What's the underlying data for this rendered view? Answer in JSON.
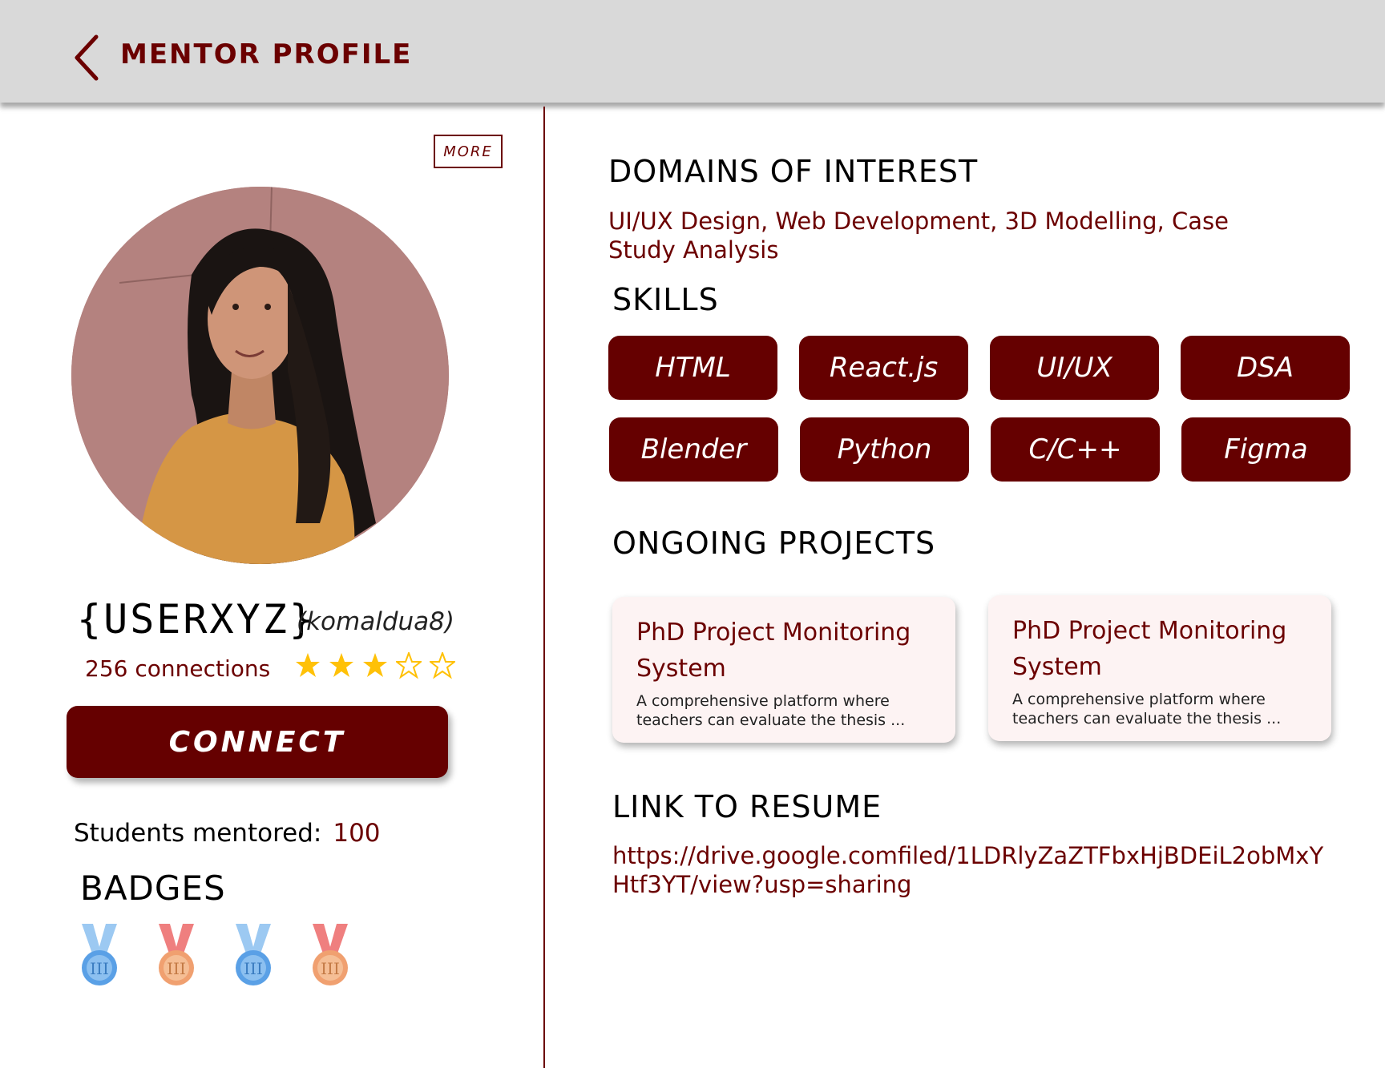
{
  "header": {
    "title": "MENTOR PROFILE",
    "back_icon": "chevron-left-icon"
  },
  "profile": {
    "more_label": "MORE",
    "username": "{USERXYZ}",
    "handle": "(komaldua8)",
    "connections": "256 connections",
    "rating": 3,
    "rating_max": 5,
    "connect_label": "CONNECT",
    "mentored_label": "Students mentored:",
    "mentored_value": "100",
    "badges_title": "BADGES",
    "badges": [
      {
        "icon": "medal-blue-icon",
        "color": "#5aa0e6"
      },
      {
        "icon": "medal-bronze-icon",
        "color": "#f0a070"
      },
      {
        "icon": "medal-blue-icon",
        "color": "#5aa0e6"
      },
      {
        "icon": "medal-bronze-icon",
        "color": "#f0a070"
      }
    ]
  },
  "domains": {
    "title": "DOMAINS OF INTEREST",
    "text": "UI/UX Design, Web Development, 3D Modelling, Case Study Analysis"
  },
  "skills": {
    "title": "SKILLS",
    "items": [
      "HTML",
      "React.js",
      "UI/UX",
      "DSA",
      "Blender",
      "Python",
      "C/C++",
      "Figma"
    ]
  },
  "projects": {
    "title": "ONGOING PROJECTS",
    "items": [
      {
        "title": "PhD Project Monitoring System",
        "desc": "A comprehensive platform where teachers can evaluate the thesis ..."
      },
      {
        "title": "PhD Project Monitoring System",
        "desc": "A comprehensive platform where teachers can evaluate the thesis ..."
      }
    ]
  },
  "resume": {
    "title": "LINK TO RESUME",
    "url": "https://drive.google.comfiled/1LDRlyZaZTFbxHjBDEiL2obMxYHtf3YT/view?usp=sharing"
  },
  "colors": {
    "accent": "#650000",
    "star": "#ffc107"
  }
}
